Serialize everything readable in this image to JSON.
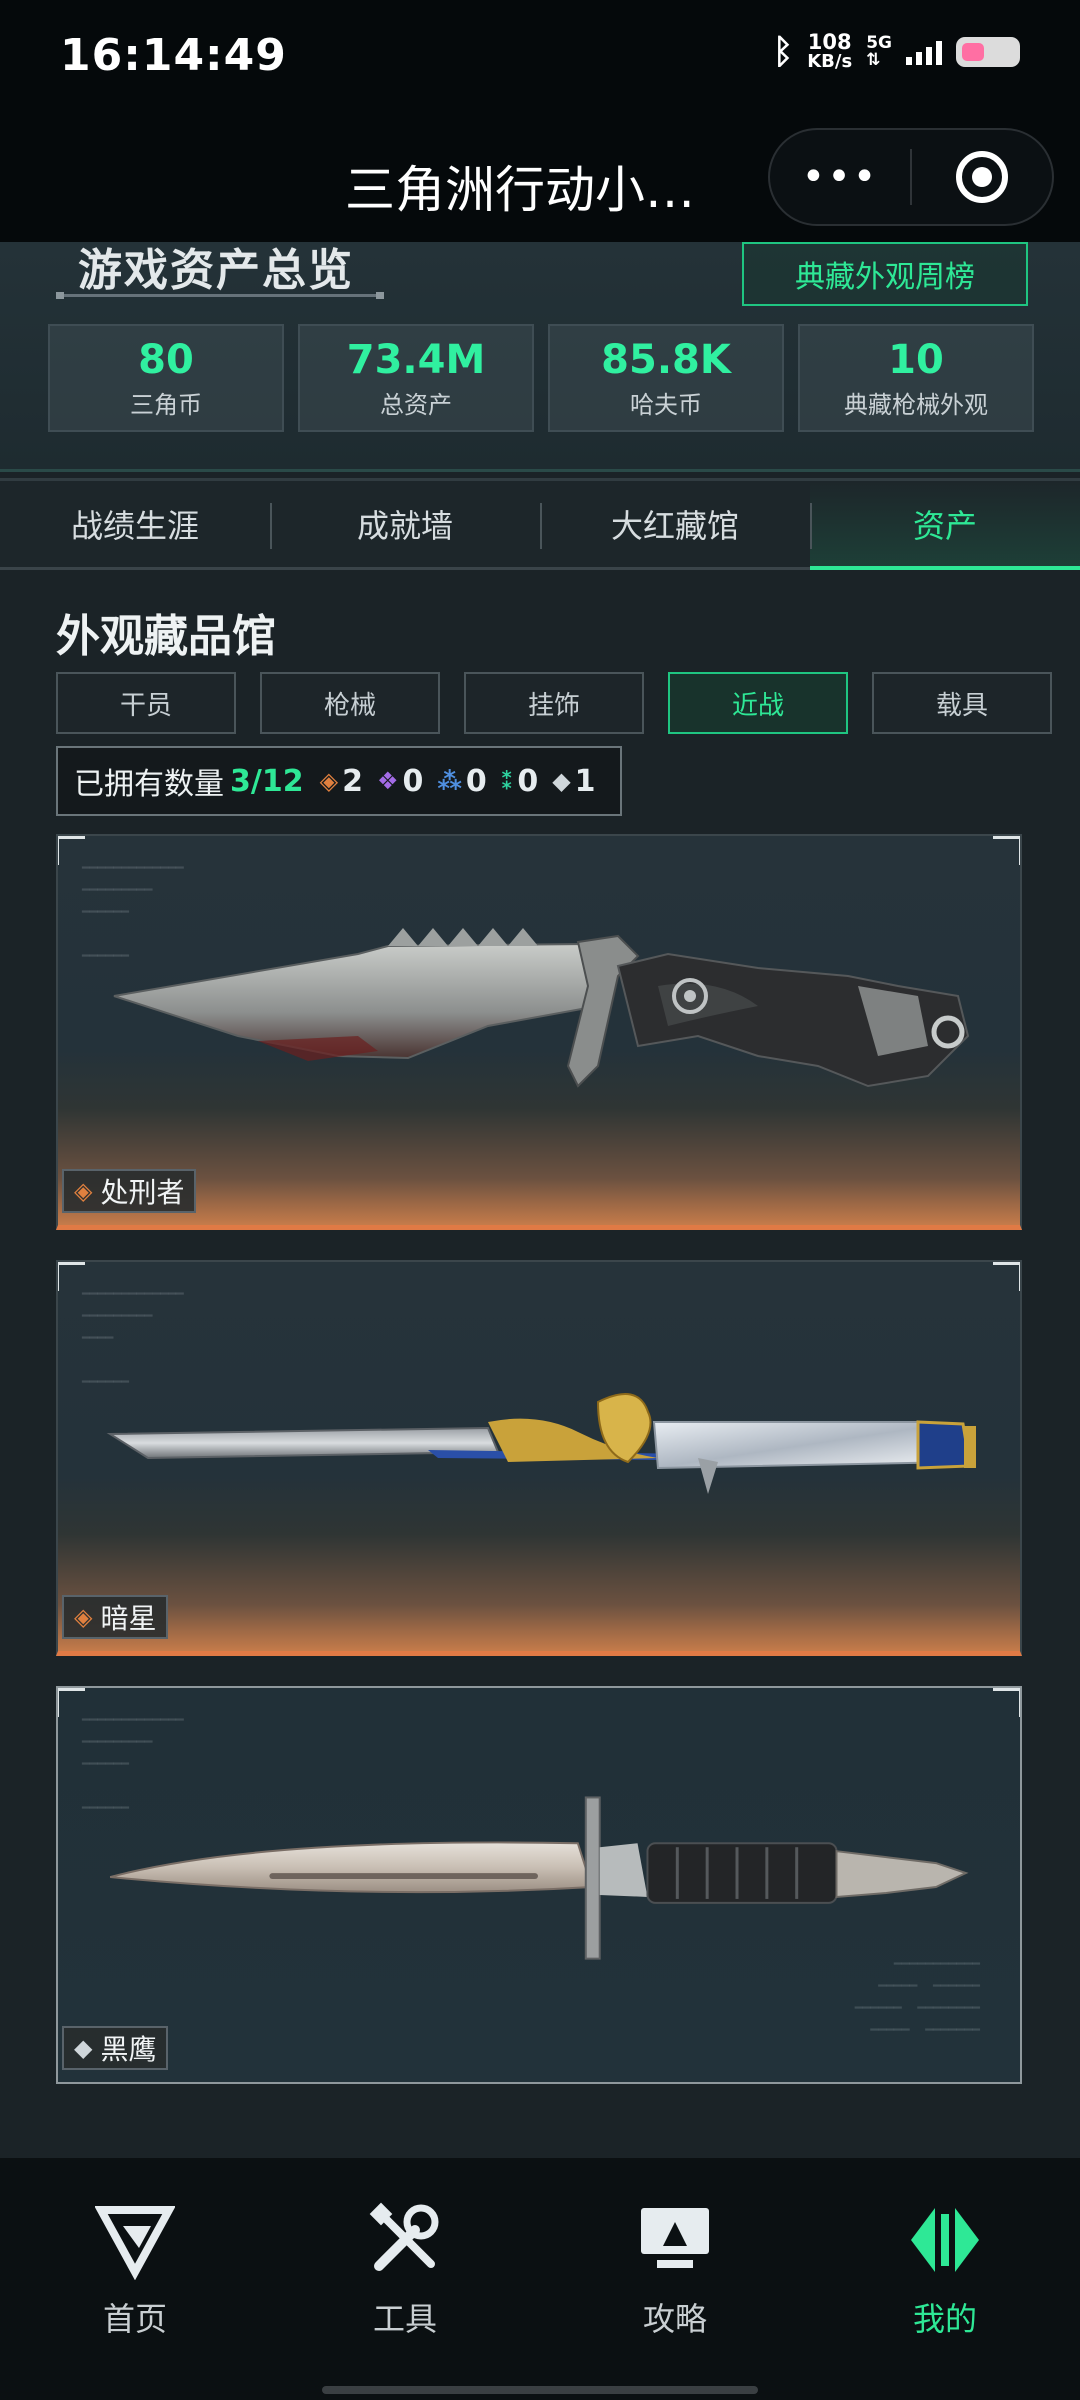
{
  "status": {
    "time": "16:14:49",
    "net_speed_value": "108",
    "net_speed_unit": "KB/s",
    "network": "5G"
  },
  "titlebar": {
    "title": "三角洲行动小…",
    "more_glyph": "•••"
  },
  "overview": {
    "title": "游戏资产总览",
    "rank_button": "典藏外观周榜",
    "stats": [
      {
        "value": "80",
        "label": "三角币"
      },
      {
        "value": "73.4M",
        "label": "总资产"
      },
      {
        "value": "85.8K",
        "label": "哈夫币"
      },
      {
        "value": "10",
        "label": "典藏枪械外观"
      }
    ]
  },
  "main_tabs": [
    {
      "label": "战绩生涯",
      "active": false
    },
    {
      "label": "成就墙",
      "active": false
    },
    {
      "label": "大红藏馆",
      "active": false
    },
    {
      "label": "资产",
      "active": true
    }
  ],
  "collection": {
    "title": "外观藏品馆",
    "sub_tabs": [
      {
        "label": "干员",
        "active": false
      },
      {
        "label": "枪械",
        "active": false
      },
      {
        "label": "挂饰",
        "active": false
      },
      {
        "label": "近战",
        "active": true
      },
      {
        "label": "载具",
        "active": false
      }
    ],
    "owned_label": "已拥有数量",
    "owned_count": "3/12",
    "rarity_counts": [
      {
        "icon": "orange-diamond-icon",
        "color": "#e0803f",
        "count": "2"
      },
      {
        "icon": "purple-diamond-icon",
        "color": "#a36be6",
        "count": "0"
      },
      {
        "icon": "blue-diamond-icon",
        "color": "#4f8fe0",
        "count": "0"
      },
      {
        "icon": "green-diamond-icon",
        "color": "#2ed3a0",
        "count": "0"
      },
      {
        "icon": "white-diamond-icon",
        "color": "#cfd6da",
        "count": "1"
      }
    ],
    "items": [
      {
        "name": "处刑者",
        "rarity_color": "#e0803f"
      },
      {
        "name": "暗星",
        "rarity_color": "#e0803f"
      },
      {
        "name": "黑鹰",
        "rarity_color": "#cfd6da"
      }
    ]
  },
  "bottom_nav": [
    {
      "label": "首页",
      "icon": "delta-logo-icon",
      "active": false
    },
    {
      "label": "工具",
      "icon": "tools-icon",
      "active": false
    },
    {
      "label": "攻略",
      "icon": "guide-monitor-icon",
      "active": false
    },
    {
      "label": "我的",
      "icon": "profile-emblem-icon",
      "active": true
    }
  ],
  "colors": {
    "accent": "#2ee896",
    "background": "#1b2327",
    "orange_rarity": "#e0803f"
  }
}
